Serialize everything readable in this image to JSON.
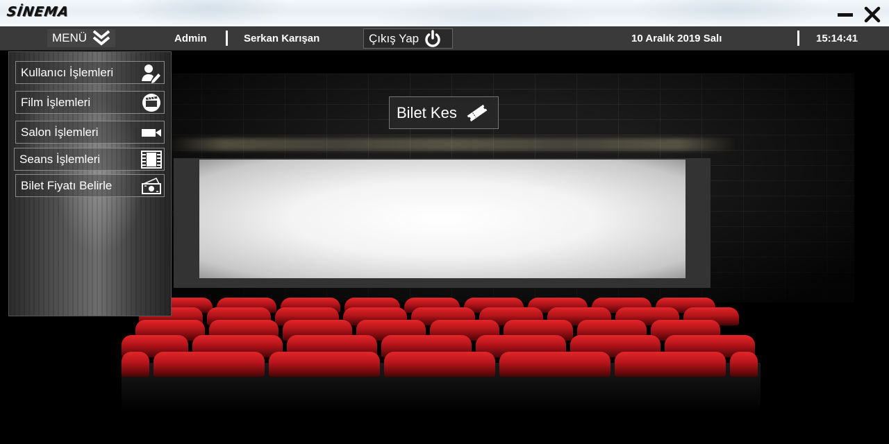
{
  "titlebar": {
    "logo": "SİNEMA",
    "minimize_icon": "minimize-icon",
    "close_icon": "close-icon"
  },
  "navbar": {
    "menu_label": "MENÜ",
    "menu_icon": "double-chevron-down-icon",
    "role": "Admin",
    "user_name": "Serkan Karışan",
    "logout_label": "Çıkış Yap",
    "logout_icon": "power-icon",
    "date": "10 Aralık 2019 Salı",
    "time": "15:14:41"
  },
  "side_menu": {
    "items": [
      {
        "label": "Kullanıcı İşlemleri",
        "icon": "user-edit-icon"
      },
      {
        "label": "Film İşlemleri",
        "icon": "film-clapper-icon"
      },
      {
        "label": "Salon İşlemleri",
        "icon": "video-camera-icon"
      },
      {
        "label": "Seans İşlemleri",
        "icon": "film-strip-icon"
      },
      {
        "label": "Bilet Fiyatı Belirle",
        "icon": "money-icon"
      }
    ]
  },
  "main": {
    "ticket_button_label": "Bilet Kes",
    "ticket_icon": "ticket-icon"
  },
  "colors": {
    "navbar_bg": "#3a3a3a",
    "seat_red": "#d11f24",
    "screen_white": "#f3f3f3"
  }
}
